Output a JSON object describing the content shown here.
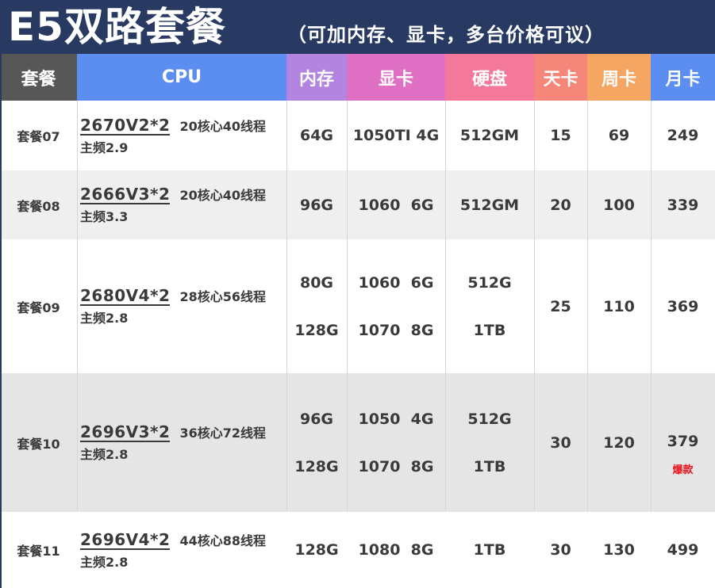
{
  "title": {
    "main": "E5双路套餐",
    "sub": "（可加内存、显卡，多台价格可议）"
  },
  "header": {
    "columns": [
      {
        "label": "套餐",
        "color": "#575757"
      },
      {
        "label": "CPU",
        "color": "#5b8ef0"
      },
      {
        "label": "内存",
        "color": "#b385e0"
      },
      {
        "label": "显卡",
        "color": "#e070c4"
      },
      {
        "label": "硬盘",
        "color": "#f47899"
      },
      {
        "label": "天卡",
        "color": "#f5877a"
      },
      {
        "label": "周卡",
        "color": "#f5a663"
      },
      {
        "label": "月卡",
        "color": "#5b8ef0"
      }
    ]
  },
  "rows": [
    {
      "package": "套餐07",
      "cpu_model": "2670V2*2",
      "cpu_cores": "20核心40线程",
      "cpu_freq": "主频2.9",
      "memory": [
        "64G"
      ],
      "gpu": [
        "1050TI 4G"
      ],
      "disk": [
        "512GM"
      ],
      "day": "15",
      "week": "69",
      "month": "249",
      "badge": ""
    },
    {
      "package": "套餐08",
      "cpu_model": "2666V3*2",
      "cpu_cores": "20核心40线程",
      "cpu_freq": "主频3.3",
      "memory": [
        "96G"
      ],
      "gpu": [
        "1060  6G"
      ],
      "disk": [
        "512GM"
      ],
      "day": "20",
      "week": "100",
      "month": "339",
      "badge": ""
    },
    {
      "package": "套餐09",
      "cpu_model": "2680V4*2",
      "cpu_cores": "28核心56线程",
      "cpu_freq": "主频2.8",
      "memory": [
        "80G",
        "128G"
      ],
      "gpu": [
        "1060  6G",
        "1070  8G"
      ],
      "disk": [
        "512G",
        "1TB"
      ],
      "day": "25",
      "week": "110",
      "month": "369",
      "badge": ""
    },
    {
      "package": "套餐10",
      "cpu_model": "2696V3*2",
      "cpu_cores": "36核心72线程",
      "cpu_freq": "主频2.8",
      "memory": [
        "96G",
        "128G"
      ],
      "gpu": [
        "1050  4G",
        "1070  8G"
      ],
      "disk": [
        "512G",
        "1TB"
      ],
      "day": "30",
      "week": "120",
      "month": "379",
      "badge": "爆款"
    },
    {
      "package": "套餐11",
      "cpu_model": "2696V4*2",
      "cpu_cores": "44核心88线程",
      "cpu_freq": "主频2.8",
      "memory": [
        "128G"
      ],
      "gpu": [
        "1080  8G"
      ],
      "disk": [
        "1TB"
      ],
      "day": "30",
      "week": "130",
      "month": "499",
      "badge": ""
    }
  ],
  "colors": {
    "title_bg": "#283a62",
    "text": "#3a3a3a",
    "hot_badge": "#e8161c",
    "row_alt_light": "#efefef",
    "row_alt_dark": "#e5e5e5"
  }
}
